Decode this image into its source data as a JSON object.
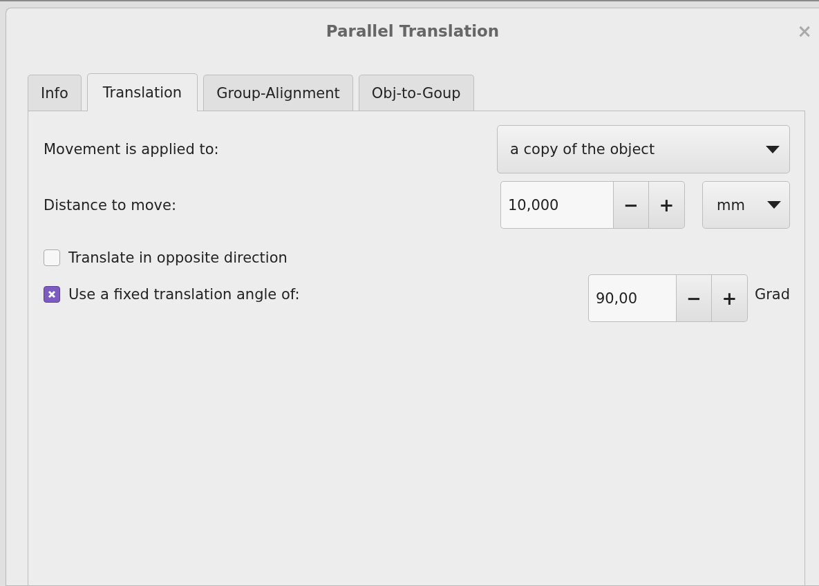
{
  "window": {
    "title": "Parallel Translation",
    "close": "×"
  },
  "tabs": [
    {
      "label": "Info",
      "selected": false
    },
    {
      "label": "Translation",
      "selected": true
    },
    {
      "label": "Group-Alignment",
      "selected": false
    },
    {
      "label": "Obj-to-Goup",
      "selected": false
    }
  ],
  "rows": [
    {
      "kind": "combo",
      "label": "Movement is applied to:",
      "value": "a copy of the object"
    },
    {
      "kind": "spin",
      "label": "Distance to move:",
      "value": "10,000",
      "decrement": "−",
      "increment": "+",
      "unit_combo": "mm"
    },
    {
      "kind": "check",
      "label": "Translate in opposite direction",
      "checked": false
    },
    {
      "kind": "check_spin",
      "label": "Use a fixed translation angle of:",
      "checked": true,
      "value": "90,00",
      "decrement": "−",
      "increment": "+",
      "unit": "Grad"
    }
  ]
}
